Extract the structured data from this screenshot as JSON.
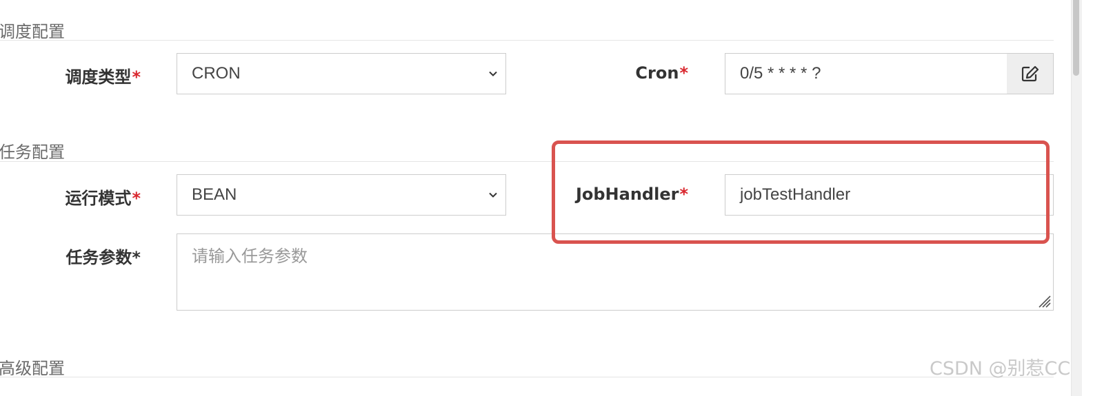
{
  "sections": {
    "schedule": "调度配置",
    "task": "任务配置",
    "advanced": "高级配置"
  },
  "schedule": {
    "type_label": "调度类型",
    "type_value": "CRON",
    "cron_label": "Cron",
    "cron_value": "0/5 * * * * ?"
  },
  "task": {
    "mode_label": "运行模式",
    "mode_value": "BEAN",
    "handler_label": "JobHandler",
    "handler_value": "jobTestHandler",
    "params_label": "任务参数*",
    "params_placeholder": "请输入任务参数"
  },
  "required_mark": "*",
  "watermark": "CSDN @别惹CC",
  "colors": {
    "required": "#d9272e",
    "highlight": "#d9534f"
  }
}
